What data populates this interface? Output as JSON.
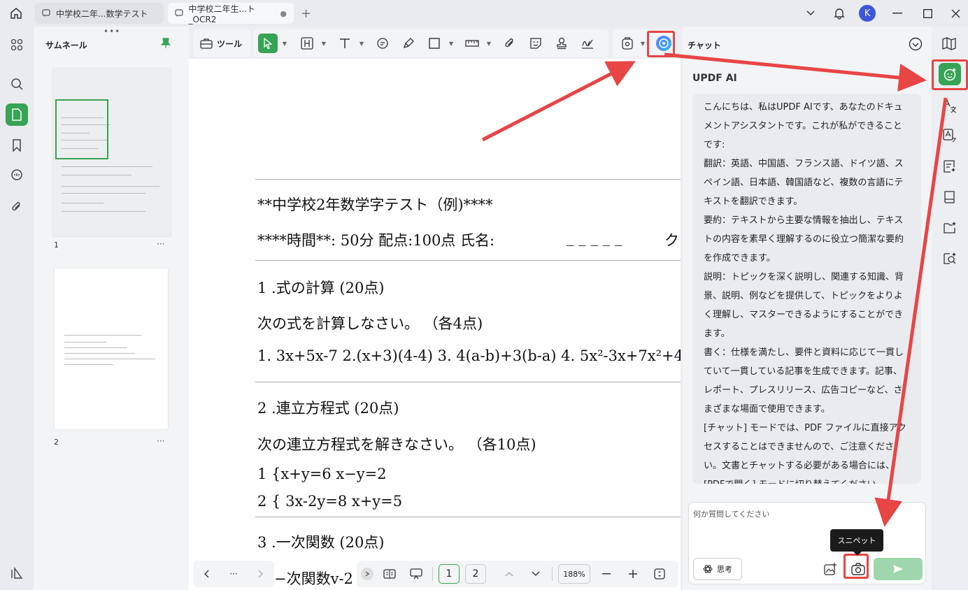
{
  "tabs": [
    {
      "label": "中学校二年...数学テスト"
    },
    {
      "label": "中学校二年生...ト_OCR2",
      "close": "●"
    }
  ],
  "tab_add": "+",
  "user": {
    "initial": "K"
  },
  "thumbnail_panel": {
    "title": "サムネール",
    "handle": "•••",
    "pages": [
      {
        "num": "1",
        "more": "···"
      },
      {
        "num": "2",
        "more": "···"
      }
    ]
  },
  "toolbar": {
    "tools_label": "ツール"
  },
  "document": {
    "lines": [
      "**中学校2年数学字テスト（例)****",
      "****時間**:  50分  配点:100点  氏名:",
      "_ _ _ _ _",
      "ク",
      "1    .式の計算  (20点)",
      "次の式を計算しなさい。 （各4点)",
      "1. 3x+5x-7    2.(x+3)(4-4)    3. 4(a-b)+3(b-a)    4. 5x²-3x+7x²+4",
      "2    .連立方程式  (20点)",
      "次の連立方程式を解きなさい。 （各10点)",
      "1 {x+y=6 x−y=2",
      "2 { 3x-2y=8 x+y=5",
      "3    .一次関数  (20点)",
      "−次関数v-2"
    ]
  },
  "bottom_nav": {
    "more": "···",
    "current_page": "1",
    "next_page": "2",
    "zoom": "188%"
  },
  "chat": {
    "title": "チャット",
    "ai_name": "UPDF AI",
    "message_paragraphs": [
      "こんにちは、私はUPDF AIです、あなたのドキュメントアシスタントです。これが私ができることです:",
      "翻訳：英語、中国語、フランス語、ドイツ語、スペイン語、日本語、韓国語など、複数の言語にテキストを翻訳できます。",
      "要約：テキストから主要な情報を抽出し、テキストの内容を素早く理解するのに役立つ簡潔な要約を作成できます。",
      "説明：トピックを深く説明し、関連する知識、背景、説明、例などを提供して、トピックをよりよく理解し、マスターできるようにすることができます。",
      "書く：仕様を満たし、要件と資料に応じて一貫していて一貫している記事を生成できます。記事、レポート、プレスリリース、広告コピーなど、さまざまな場面で使用できます。",
      "[チャット] モードでは、PDF ファイルに直接アクセスすることはできませんので、ご注意ください。文書とチャットする必要がある場合には、[PDFで開く] モードに切り替えてください。"
    ],
    "input_placeholder": "何か質問してください",
    "think_label": "思考",
    "tooltip": "スニペット"
  },
  "colors": {
    "accent_green": "#37a354",
    "highlight_red": "#e84545"
  }
}
